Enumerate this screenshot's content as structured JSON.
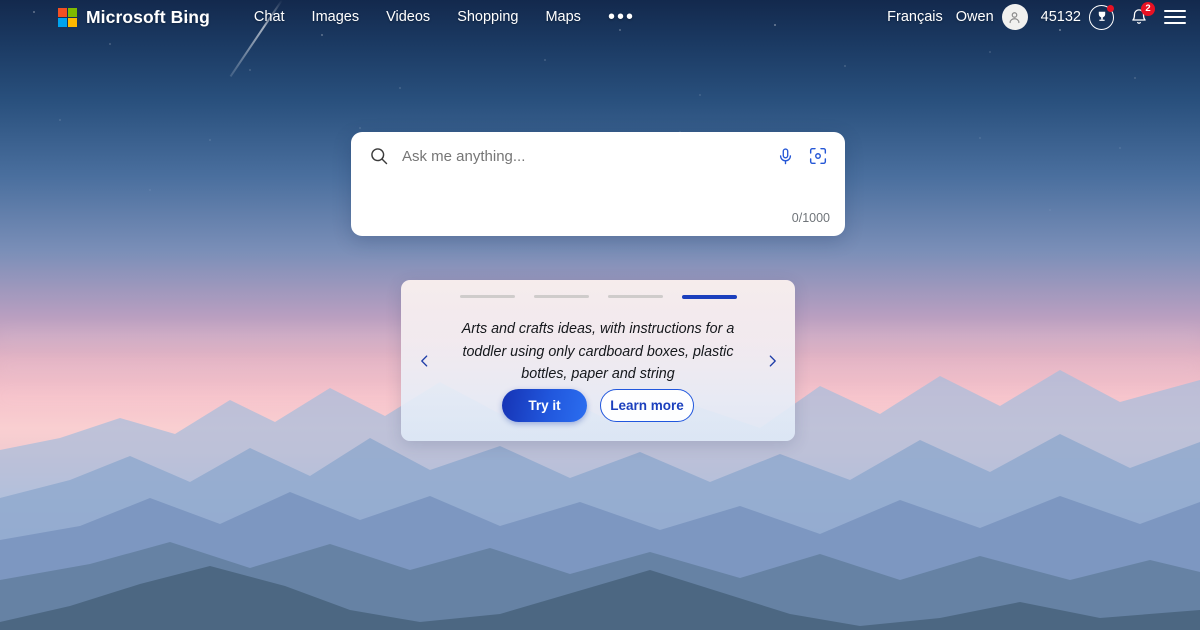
{
  "brand": {
    "name": "Microsoft Bing",
    "logo_icon": "microsoft-squares-icon",
    "logo_colors": [
      "#f25022",
      "#7fba00",
      "#00a4ef",
      "#ffb900"
    ]
  },
  "nav": {
    "items": [
      {
        "label": "Chat",
        "name": "nav-item-chat"
      },
      {
        "label": "Images",
        "name": "nav-item-images"
      },
      {
        "label": "Videos",
        "name": "nav-item-videos"
      },
      {
        "label": "Shopping",
        "name": "nav-item-shopping"
      },
      {
        "label": "Maps",
        "name": "nav-item-maps"
      }
    ],
    "more_label": "•••",
    "more_icon": "ellipsis-icon"
  },
  "header_right": {
    "language": "Français",
    "user_name": "Owen",
    "avatar_icon": "person-avatar-icon",
    "rewards_points": "45132",
    "rewards_icon": "trophy-icon",
    "rewards_has_alert": true,
    "notifications_icon": "bell-icon",
    "notifications_count": "2",
    "menu_icon": "hamburger-menu-icon",
    "badge_color": "#e81123"
  },
  "search": {
    "placeholder": "Ask me anything...",
    "value": "",
    "counter": "0/1000",
    "search_icon": "search-magnifier-icon",
    "mic_icon": "microphone-icon",
    "visual_search_icon": "camera-visual-search-icon",
    "accent_color": "#2557d6"
  },
  "carousel": {
    "prev_icon": "chevron-left-icon",
    "next_icon": "chevron-right-icon",
    "slide_count": 4,
    "active_slide": 4,
    "active_color": "#1b3fbd",
    "inactive_color": "#cfcccb",
    "prompt": "Arts and crafts ideas, with instructions for a toddler using only cardboard boxes, plastic bottles, paper and string",
    "primary_button": "Try it",
    "secondary_button": "Learn more"
  },
  "background": {
    "scene": "mountain-sunset-starry-sky",
    "sky_top": "#13294d",
    "sky_mid": "#f9cfd1",
    "mountains": "#8fa8cd"
  }
}
